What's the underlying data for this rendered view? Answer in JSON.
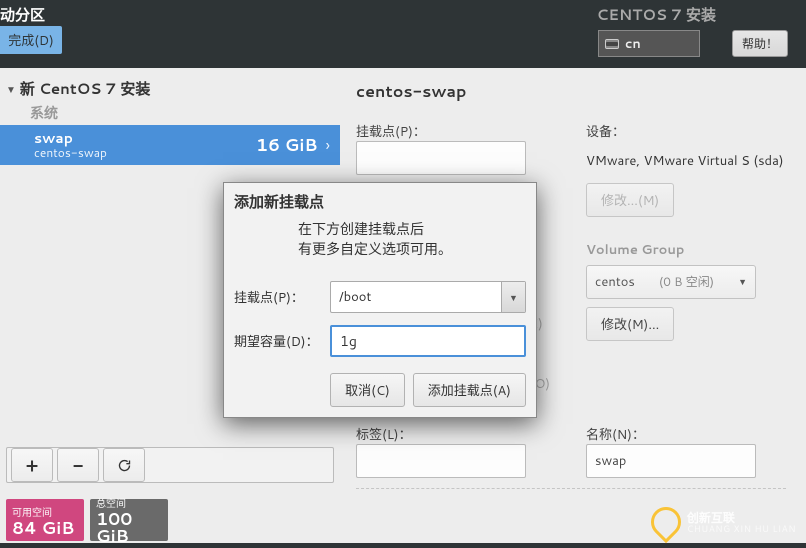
{
  "top": {
    "partition_label": "动分区",
    "done_label": "完成(D)",
    "installer_title": "CENTOS 7 安装",
    "lang_code": "cn",
    "help_label": "帮助！"
  },
  "left": {
    "section_title": "新 CentOS 7 安装",
    "subheading": "系统",
    "item": {
      "name": "swap",
      "sub": "centos-swap",
      "size": "16 GiB"
    },
    "space_free_label": "可用空间",
    "space_free_value": "84 GiB",
    "space_total_label": "总空间",
    "space_total_value": "100 GiB"
  },
  "right": {
    "title": "centos-swap",
    "mount_label": "挂载点(P)：",
    "device_label": "设备：",
    "device_value": "VMware, VMware Virtual S (sda)",
    "modify1_label": "修改...(M)",
    "vg_label": "Volume Group",
    "vg_name": "centos",
    "vg_free": "(0 B 空闲)",
    "modify2_label": "修改(M)...",
    "e_hint": "E)",
    "o_hint": "(O)",
    "label_label": "标签(L)：",
    "name_label": "名称(N)：",
    "name_value": "swap"
  },
  "modal": {
    "title": "添加新挂载点",
    "desc_l1": "在下方创建挂载点后",
    "desc_l2": "有更多自定义选项可用。",
    "mount_label": "挂载点(P)：",
    "mount_value": "/boot",
    "capacity_label": "期望容量(D)：",
    "capacity_value": "1g",
    "cancel_label": "取消(C)",
    "add_label": "添加挂载点(A)"
  },
  "watermark": {
    "cn": "创新互联",
    "en": "CHUANG XIN HU LIAN"
  }
}
